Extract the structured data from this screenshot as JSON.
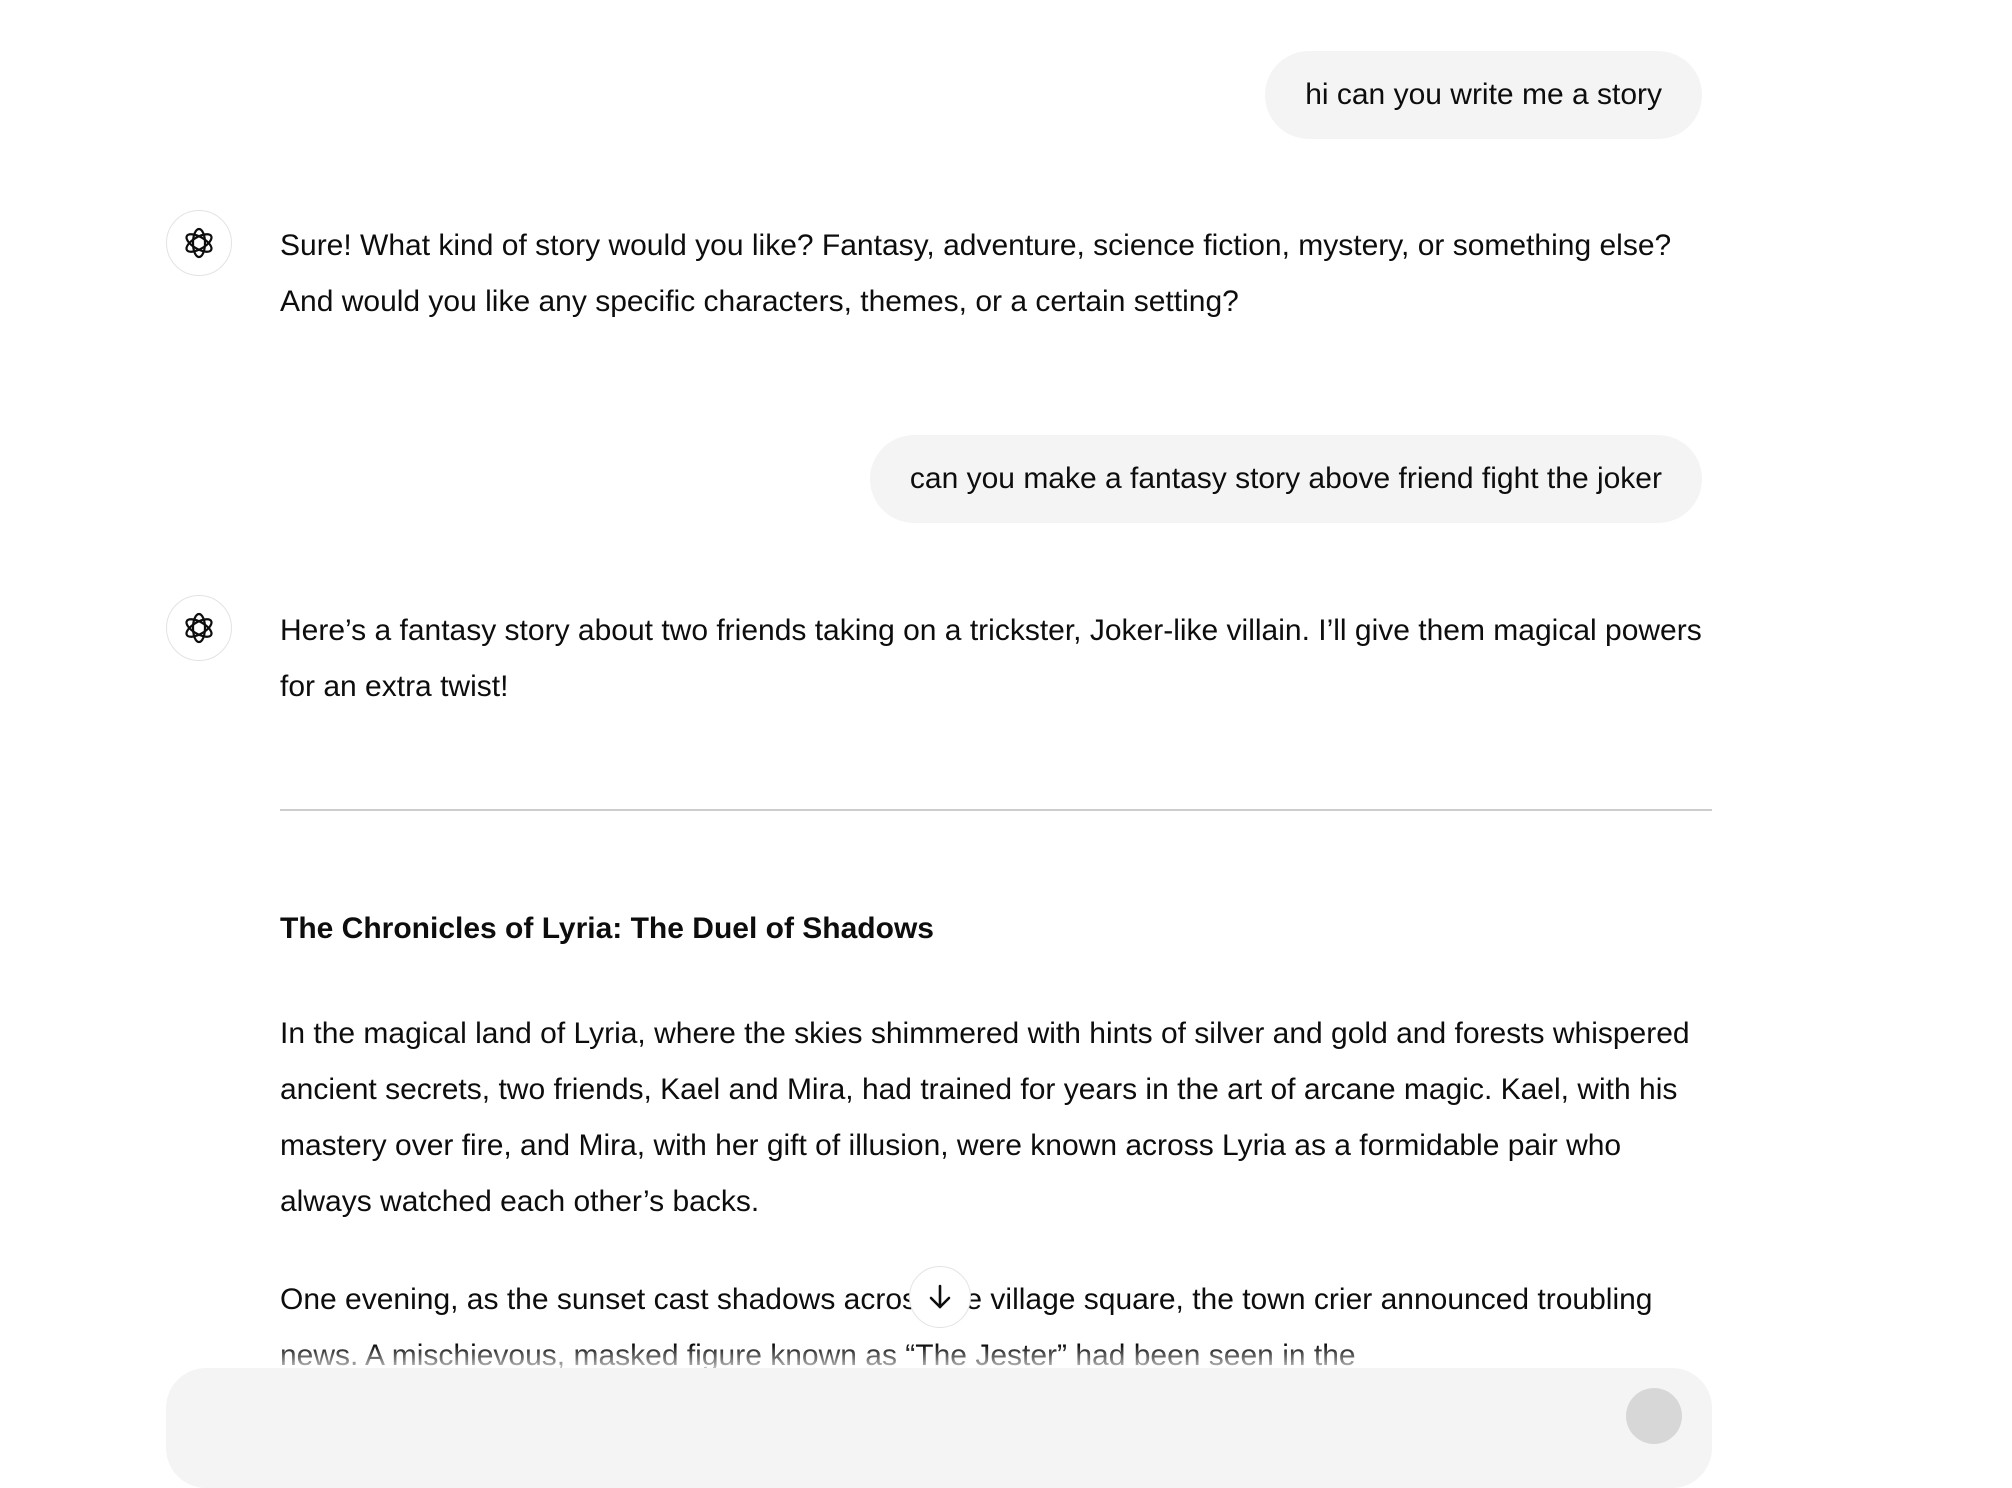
{
  "conversation": {
    "messages": [
      {
        "role": "user",
        "text": "hi can you write me a story"
      },
      {
        "role": "assistant",
        "text": "Sure! What kind of story would you like? Fantasy, adventure, science fiction, mystery, or something else? And would you like any specific characters, themes, or a certain setting?"
      },
      {
        "role": "user",
        "text": "can you make a fantasy story above friend fight the joker"
      },
      {
        "role": "assistant",
        "text": "Here’s a fantasy story about two friends taking on a trickster, Joker-like villain. I’ll give them magical powers for an extra twist!"
      }
    ],
    "story": {
      "title": "The Chronicles of Lyria: The Duel of Shadows",
      "paragraphs": [
        "In the magical land of Lyria, where the skies shimmered with hints of silver and gold and forests whispered ancient secrets, two friends, Kael and Mira, had trained for years in the art of arcane magic. Kael, with his mastery over fire, and Mira, with her gift of illusion, were known across Lyria as a formidable pair who always watched each other’s backs.",
        "One evening, as the sunset cast shadows across the village square, the town crier announced troubling news. A mischievous, masked figure known as “The Jester” had been seen in the"
      ]
    }
  },
  "icons": {
    "assistant_avatar": "openai-logo-icon",
    "scroll_down": "arrow-down-icon"
  },
  "colors": {
    "user_bubble_bg": "#f4f4f4",
    "text": "#0d0d0d",
    "divider": "#cdcdcd",
    "border": "#e3e3e3"
  }
}
